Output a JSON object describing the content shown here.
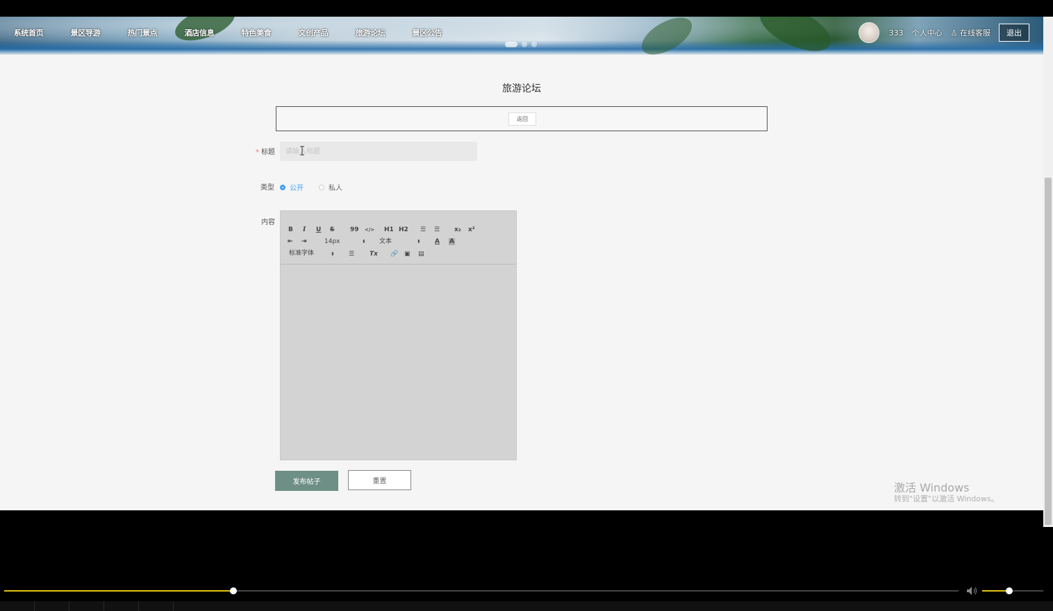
{
  "nav": {
    "items": [
      "系统首页",
      "景区导游",
      "热门景点",
      "酒店信息",
      "特色美食",
      "文创产品",
      "旅游论坛",
      "景区公告"
    ]
  },
  "user": {
    "name": "333",
    "center": "个人中心",
    "service": "在线客服",
    "logout": "退出"
  },
  "page": {
    "title": "旅游论坛",
    "back": "返回"
  },
  "form": {
    "title_label": "标题",
    "title_placeholder": "请输入标题",
    "type_label": "类型",
    "type_options": [
      "公开",
      "私人"
    ],
    "type_selected": "公开",
    "content_label": "内容",
    "submit": "发布帖子",
    "reset": "重置"
  },
  "editor": {
    "font_size": "14px",
    "header": "文本",
    "font_family": "标准字体",
    "tools": {
      "bold": "B",
      "italic": "I",
      "underline": "U",
      "strike": "S",
      "quote": "99",
      "code": "</>",
      "h1": "H1",
      "h2": "H2",
      "sub": "x₂",
      "sup": "x²",
      "color": "A",
      "bg": "A",
      "clean": "Tx"
    }
  },
  "watermark": {
    "line1": "激活 Windows",
    "line2": "转到\"设置\"以激活 Windows。"
  },
  "player": {
    "progress": 0.24,
    "volume": 0.44
  },
  "colors": {
    "accent": "#409eff",
    "submit": "#6e8f86",
    "seek": "#e5c414"
  }
}
